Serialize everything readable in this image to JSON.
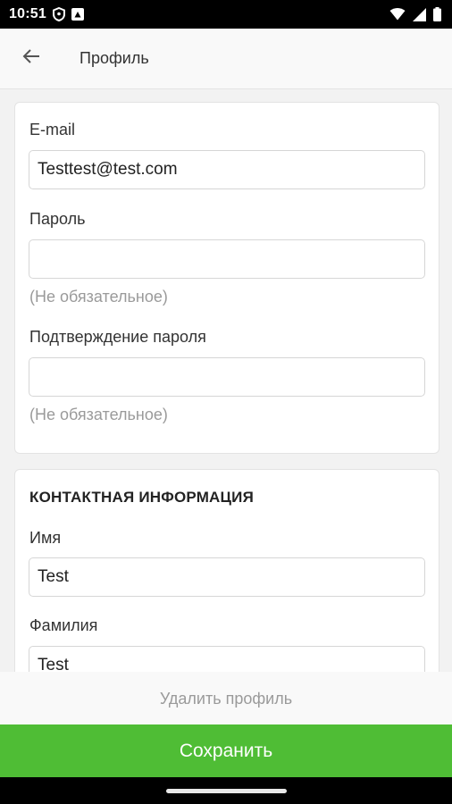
{
  "status_bar": {
    "time": "10:51",
    "icons": [
      "vpn-shield-icon",
      "notification-icon",
      "wifi-icon",
      "cellular-signal-icon",
      "battery-icon"
    ]
  },
  "app_bar": {
    "title": "Профиль",
    "back_icon": "arrow-left-icon"
  },
  "account": {
    "email_label": "E-mail",
    "email_value": "Testtest@test.com",
    "password_label": "Пароль",
    "password_value": "",
    "password_hint": "(Не обязательное)",
    "confirm_label": "Подтверждение пароля",
    "confirm_value": "",
    "confirm_hint": "(Не обязательное)"
  },
  "contact": {
    "section_title": "КОНТАКТНАЯ ИНФОРМАЦИЯ",
    "first_name_label": "Имя",
    "first_name_value": "Test",
    "last_name_label": "Фамилия",
    "last_name_value": "Test"
  },
  "actions": {
    "delete_label": "Удалить профиль",
    "save_label": "Сохранить"
  },
  "colors": {
    "accent": "#4fbd35",
    "hint": "#9a9a9a"
  }
}
